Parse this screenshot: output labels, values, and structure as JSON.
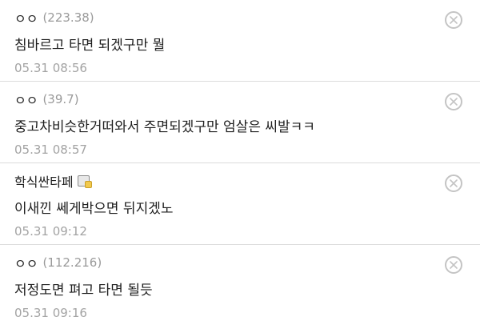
{
  "comments": [
    {
      "nick": "ㅇㅇ",
      "ip": "(223.38)",
      "body": "침바르고 타면 되겠구만 뭘",
      "date": "05.31 08:56"
    },
    {
      "nick": "ㅇㅇ",
      "ip": "(39.7)",
      "body": "중고차비슷한거떠와서 주면되겠구만 엄살은 씨발ㅋㅋ",
      "date": "05.31 08:57"
    },
    {
      "nick": "학식싼타페",
      "ip": "",
      "body": "이새낀 쎄게박으면 뒤지겠노",
      "date": "05.31 09:12"
    },
    {
      "nick": "ㅇㅇ",
      "ip": "(112.216)",
      "body": "저정도면 펴고 타면 될듯",
      "date": "05.31 09:16"
    }
  ],
  "icons": {
    "delete": "close-circle-icon",
    "member_badge": "fixed-nick-badge-icon"
  },
  "colors": {
    "separator": "#dcdcdc",
    "meta_text": "#a3a3a3",
    "close_icon": "#c4c4c4"
  }
}
